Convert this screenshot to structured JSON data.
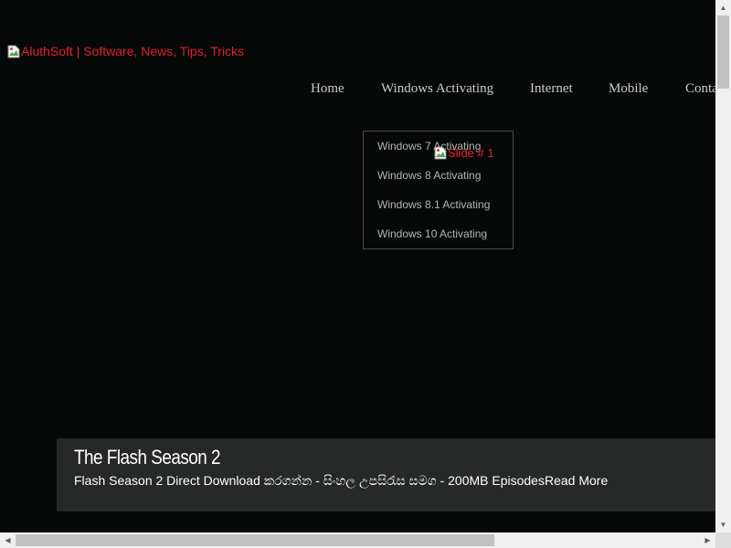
{
  "header": {
    "logo_alt": "AluthSoft | Software, News, Tips, Tricks"
  },
  "nav": {
    "items": [
      {
        "label": "Home"
      },
      {
        "label": "Windows Activating"
      },
      {
        "label": "Internet"
      },
      {
        "label": "Mobile"
      },
      {
        "label": "Conta"
      }
    ],
    "dropdown": [
      {
        "label": "Windows 7 Activating"
      },
      {
        "label": "Windows 8 Activating"
      },
      {
        "label": "Windows 8.1 Activating"
      },
      {
        "label": "Windows 10 Activating"
      }
    ]
  },
  "slider": {
    "image_alt": "Slide # 1",
    "title": "The Flash Season 2",
    "description": "Flash Season 2 Direct Download කරගන්න - සිංහල උපසිරැස සමග - 200MB Episodes",
    "read_more": "Read More"
  },
  "colors": {
    "background": "#070909",
    "link_red": "#e0202a",
    "nav_text": "#c9c9c9",
    "caption_bg": "#272828"
  }
}
